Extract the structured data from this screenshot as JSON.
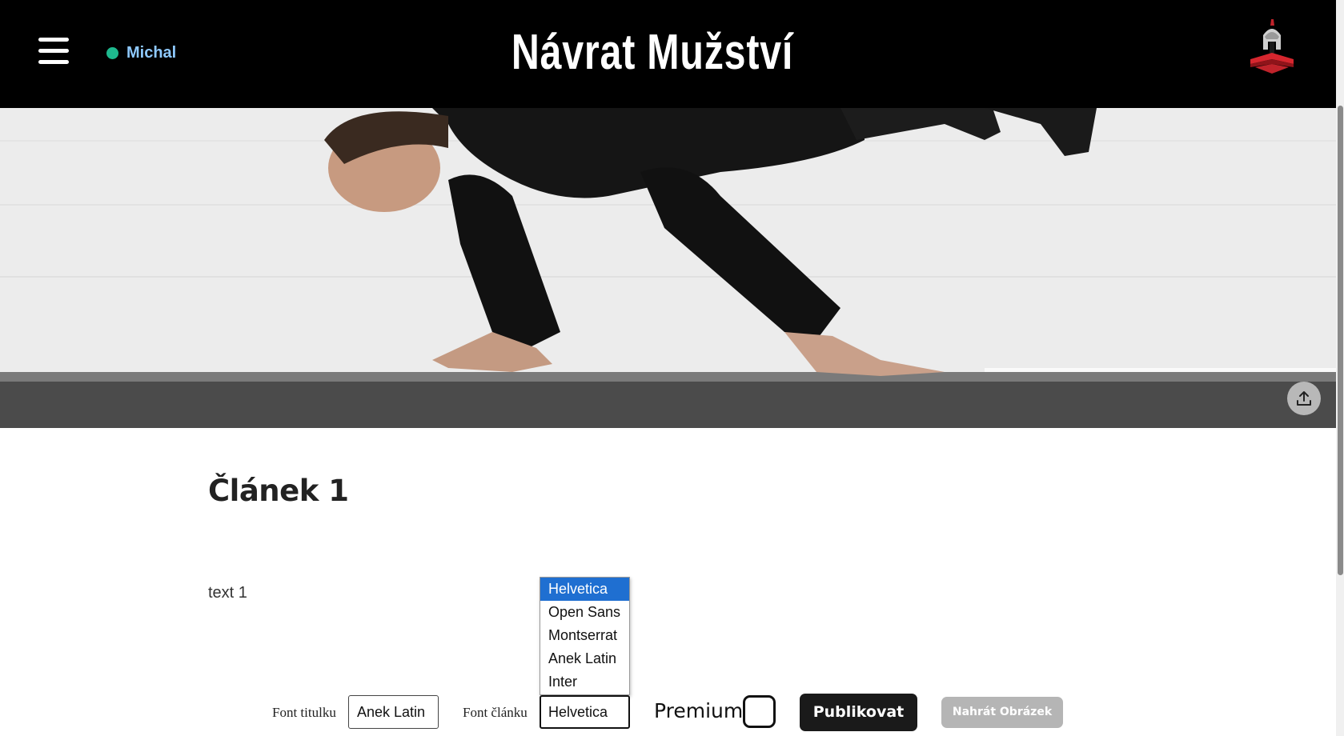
{
  "header": {
    "user_name": "Michal",
    "site_title": "Návrat Mužství"
  },
  "article": {
    "title": "Článek 1",
    "text": "text 1"
  },
  "dropdown": {
    "options": [
      "Helvetica",
      "Open Sans",
      "Montserrat",
      "Anek Latin",
      "Inter"
    ],
    "selected": "Helvetica"
  },
  "controls": {
    "title_font_label": "Font titulku",
    "title_font_value": "Anek Latin",
    "article_font_label": "Font článku",
    "article_font_value": "Helvetica",
    "premium_label": "Premium",
    "premium_checked": false,
    "publish_label": "Publikovat",
    "upload_label": "Nahrát Obrázek"
  },
  "icons": {
    "menu": "hamburger-icon",
    "status": "online-dot",
    "logo": "spartan-helmet-logo",
    "upload": "upload-icon"
  },
  "colors": {
    "header_bg": "#000000",
    "user_name": "#8ec9ff",
    "status_dot": "#1eb98e",
    "selected_option": "#1f6fd1",
    "publish_bg": "#1a1a1a",
    "upload_bg": "#b5b5b5"
  }
}
